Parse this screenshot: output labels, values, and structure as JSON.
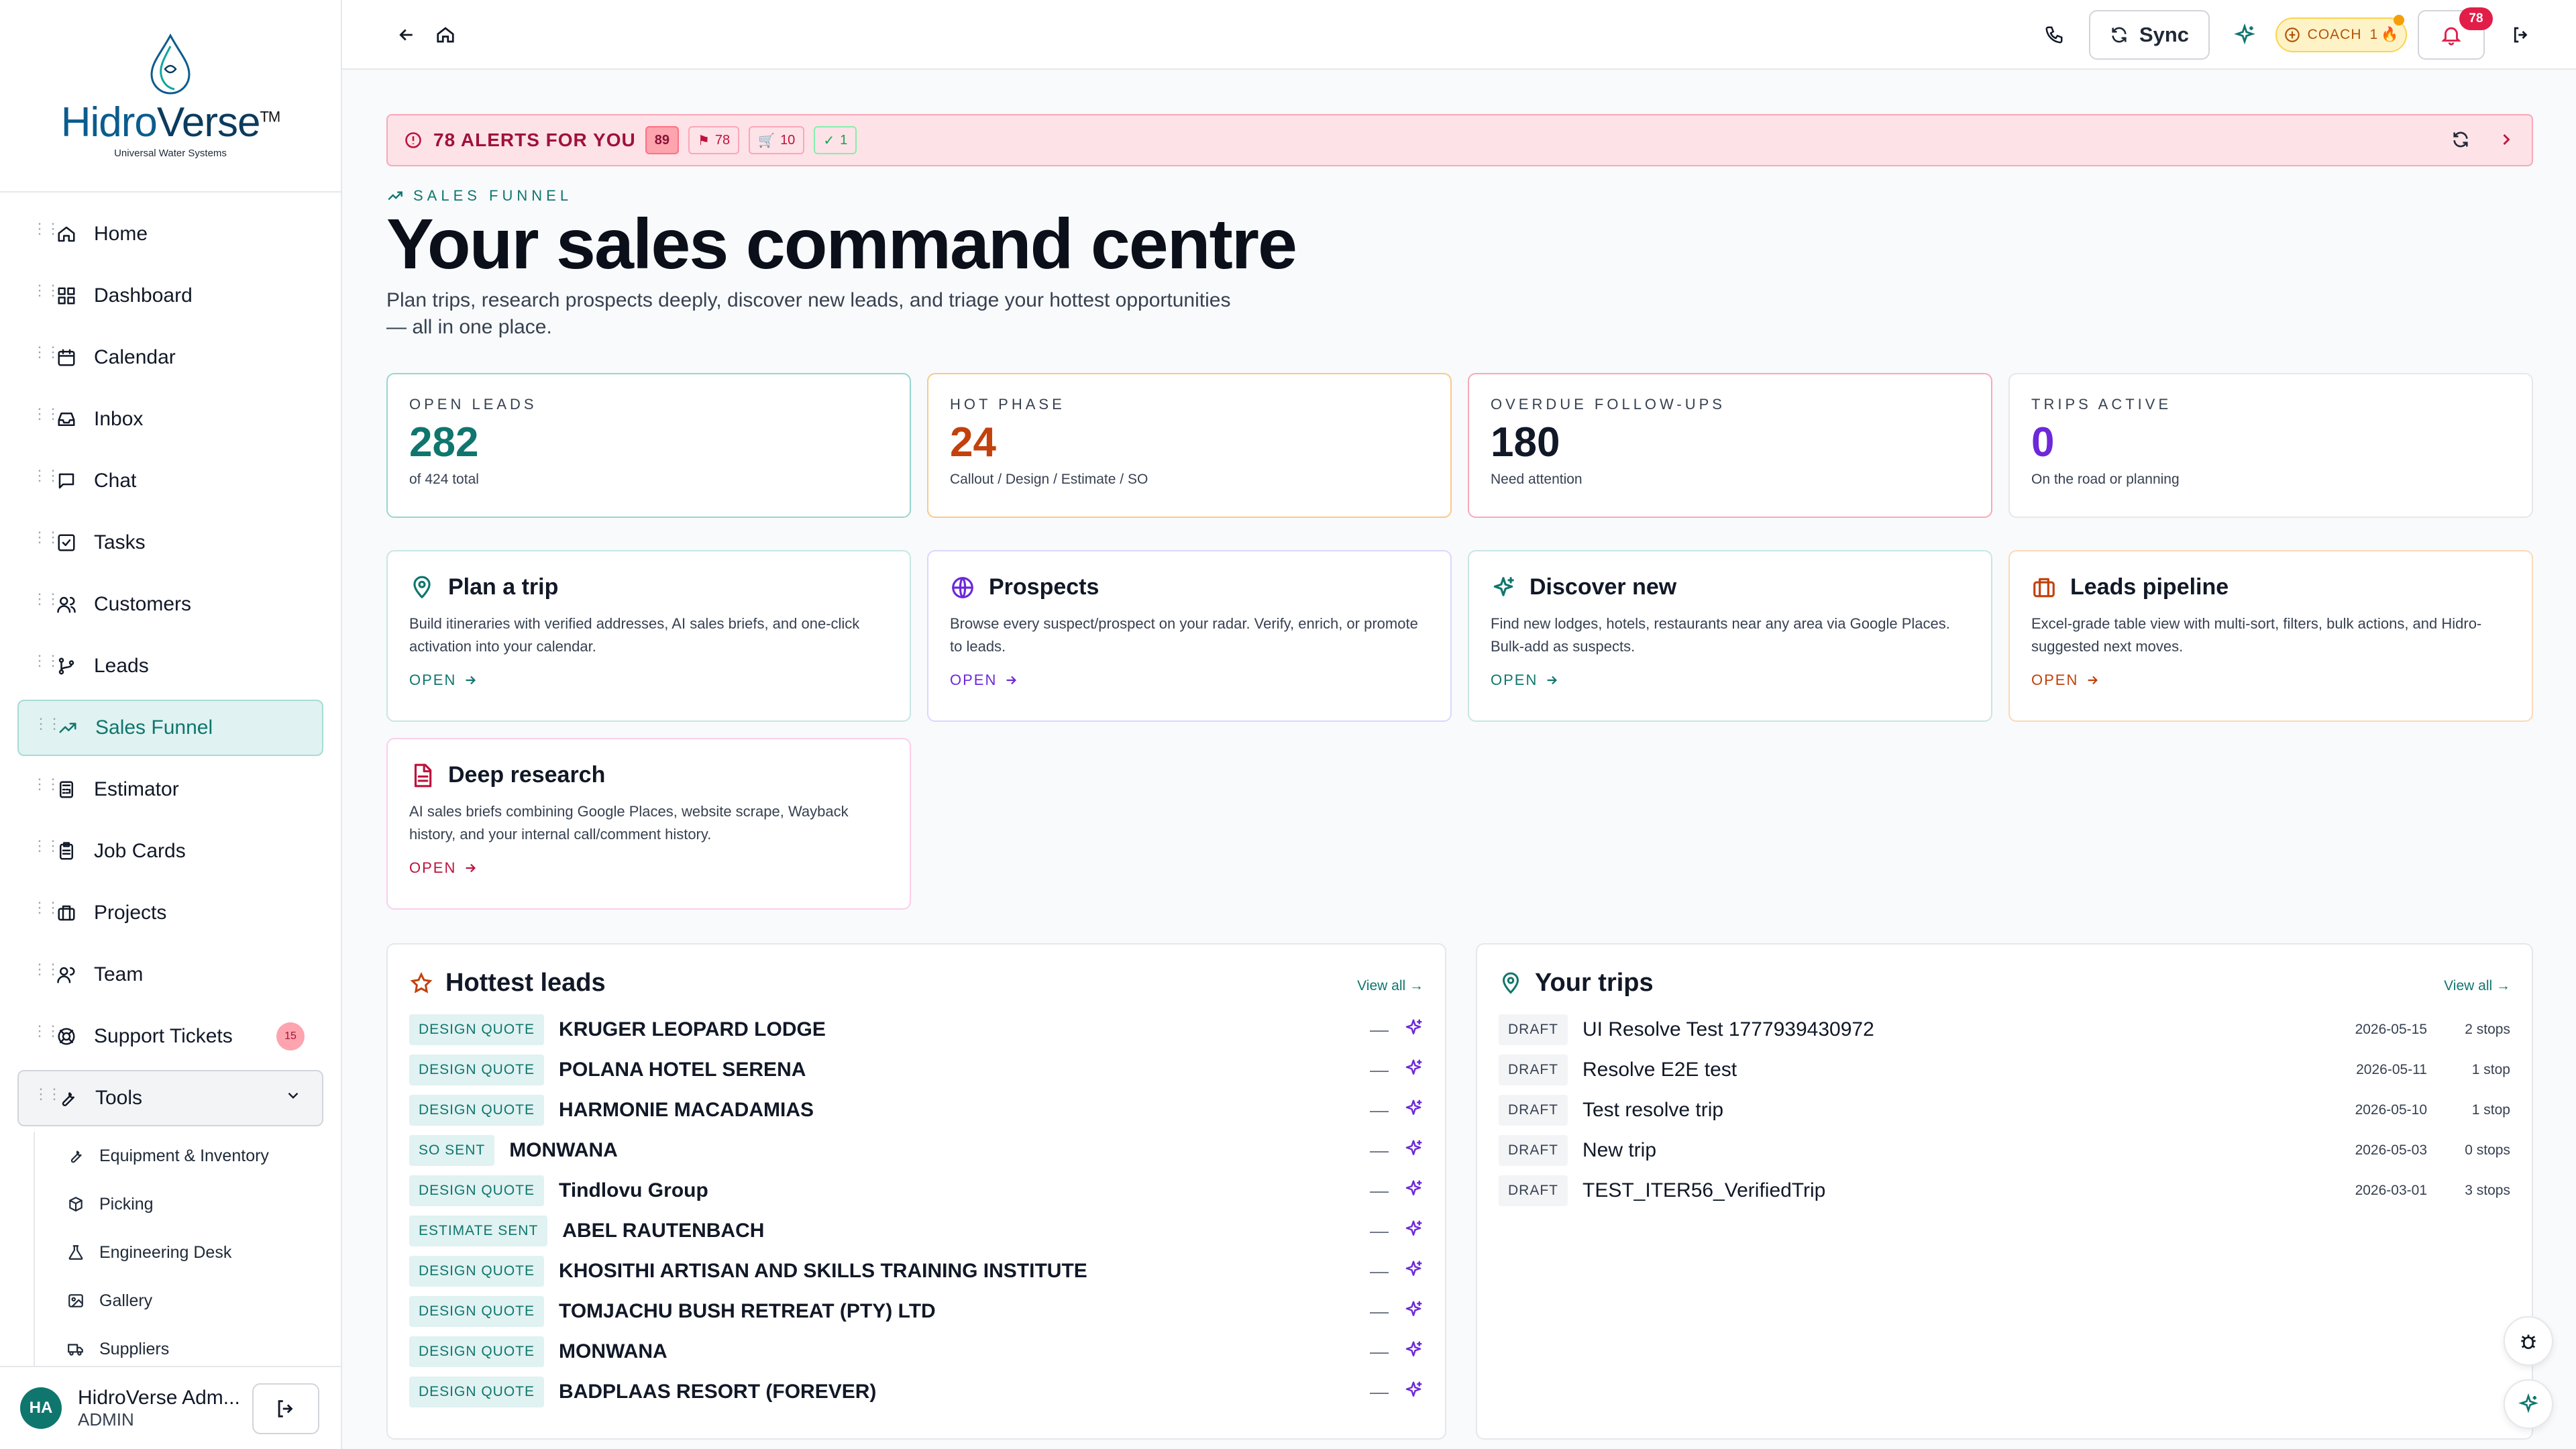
{
  "brand": {
    "name_a": "Hidro",
    "name_b": "Verse",
    "tm": "TM",
    "tagline": "Universal Water Systems"
  },
  "sidebar": {
    "items": [
      {
        "label": "Home",
        "icon": "home-icon"
      },
      {
        "label": "Dashboard",
        "icon": "dashboard-icon"
      },
      {
        "label": "Calendar",
        "icon": "calendar-icon"
      },
      {
        "label": "Inbox",
        "icon": "inbox-icon"
      },
      {
        "label": "Chat",
        "icon": "chat-icon"
      },
      {
        "label": "Tasks",
        "icon": "tasks-icon"
      },
      {
        "label": "Customers",
        "icon": "customers-icon"
      },
      {
        "label": "Leads",
        "icon": "leads-icon"
      },
      {
        "label": "Sales Funnel",
        "icon": "trending-up-icon",
        "active": true
      },
      {
        "label": "Estimator",
        "icon": "calculator-icon"
      },
      {
        "label": "Job Cards",
        "icon": "clipboard-icon"
      },
      {
        "label": "Projects",
        "icon": "briefcase-icon"
      },
      {
        "label": "Team",
        "icon": "team-icon"
      },
      {
        "label": "Support Tickets",
        "icon": "lifebuoy-icon",
        "badge": "15"
      },
      {
        "label": "Tools",
        "icon": "wrench-icon"
      }
    ],
    "tools_sub": [
      {
        "label": "Equipment & Inventory",
        "icon": "wrench-icon"
      },
      {
        "label": "Picking",
        "icon": "package-icon"
      },
      {
        "label": "Engineering Desk",
        "icon": "flask-icon"
      },
      {
        "label": "Gallery",
        "icon": "image-icon"
      },
      {
        "label": "Suppliers",
        "icon": "truck-icon"
      }
    ],
    "user": {
      "initials": "HA",
      "name": "HidroVerse Adm...",
      "role": "ADMIN"
    }
  },
  "topbar": {
    "sync_label": "Sync",
    "coach_label": "COACH",
    "coach_count": "1",
    "notifications": "78"
  },
  "alerts": {
    "title": "78 ALERTS FOR YOU",
    "total": "89",
    "chip_urgent": "78",
    "chip_cart": "10",
    "chip_ok": "1"
  },
  "hero": {
    "eyebrow": "SALES FUNNEL",
    "title": "Your sales command centre",
    "subtitle_1": "Plan trips, research prospects deeply, discover new leads, and triage your hottest opportunities",
    "subtitle_2": "— all in one place."
  },
  "stats": [
    {
      "label": "OPEN LEADS",
      "value": "282",
      "note": "of 424 total",
      "color": "#0f766e"
    },
    {
      "label": "HOT PHASE",
      "value": "24",
      "note": "Callout / Design / Estimate / SO",
      "color": "#c2410c"
    },
    {
      "label": "OVERDUE FOLLOW-UPS",
      "value": "180",
      "note": "Need attention",
      "color": "#111827"
    },
    {
      "label": "TRIPS ACTIVE",
      "value": "0",
      "note": "On the road or planning",
      "color": "#6d28d9"
    }
  ],
  "cards": [
    {
      "title": "Plan a trip",
      "desc": "Build itineraries with verified addresses, AI sales briefs, and one-click activation into your calendar.",
      "open": "OPEN",
      "color": "#0f766e",
      "icon": "map-pin-icon"
    },
    {
      "title": "Prospects",
      "desc": "Browse every suspect/prospect on your radar. Verify, enrich, or promote to leads.",
      "open": "OPEN",
      "color": "#6d28d9",
      "icon": "globe-icon"
    },
    {
      "title": "Discover new",
      "desc": "Find new lodges, hotels, restaurants near any area via Google Places. Bulk-add as suspects.",
      "open": "OPEN",
      "color": "#0f766e",
      "icon": "sparkles-icon"
    },
    {
      "title": "Leads pipeline",
      "desc": "Excel-grade table view with multi-sort, filters, bulk actions, and Hidro-suggested next moves.",
      "open": "OPEN",
      "color": "#c2410c",
      "icon": "briefcase-icon"
    },
    {
      "title": "Deep research",
      "desc": "AI sales briefs combining Google Places, website scrape, Wayback history, and your internal call/comment history.",
      "open": "OPEN",
      "color": "#be123c",
      "icon": "document-icon"
    }
  ],
  "hottest": {
    "title": "Hottest leads",
    "view_all": "View all →",
    "rows": [
      {
        "tag": "DESIGN QUOTE",
        "name": "KRUGER LEOPARD LODGE",
        "dash": "—"
      },
      {
        "tag": "DESIGN QUOTE",
        "name": "POLANA HOTEL SERENA",
        "dash": "—"
      },
      {
        "tag": "DESIGN QUOTE",
        "name": "HARMONIE MACADAMIAS",
        "dash": "—"
      },
      {
        "tag": "SO SENT",
        "name": "MONWANA",
        "dash": "—"
      },
      {
        "tag": "DESIGN QUOTE",
        "name": "Tindlovu Group",
        "dash": "—"
      },
      {
        "tag": "ESTIMATE SENT",
        "name": "ABEL RAUTENBACH",
        "dash": "—"
      },
      {
        "tag": "DESIGN QUOTE",
        "name": "KHOSITHI ARTISAN AND SKILLS TRAINING INSTITUTE",
        "dash": "—"
      },
      {
        "tag": "DESIGN QUOTE",
        "name": "TOMJACHU BUSH RETREAT (PTY) LTD",
        "dash": "—"
      },
      {
        "tag": "DESIGN QUOTE",
        "name": "MONWANA",
        "dash": "—"
      },
      {
        "tag": "DESIGN QUOTE",
        "name": "BADPLAAS RESORT (FOREVER)",
        "dash": "—"
      }
    ]
  },
  "trips": {
    "title": "Your trips",
    "view_all": "View all →",
    "rows": [
      {
        "tag": "DRAFT",
        "name": "UI Resolve Test 1777939430972",
        "date": "2026-05-15",
        "stops": "2 stops"
      },
      {
        "tag": "DRAFT",
        "name": "Resolve E2E test",
        "date": "2026-05-11",
        "stops": "1 stop"
      },
      {
        "tag": "DRAFT",
        "name": "Test resolve trip",
        "date": "2026-05-10",
        "stops": "1 stop"
      },
      {
        "tag": "DRAFT",
        "name": "New trip",
        "date": "2026-05-03",
        "stops": "0 stops"
      },
      {
        "tag": "DRAFT",
        "name": "TEST_ITER56_VerifiedTrip",
        "date": "2026-03-01",
        "stops": "3 stops"
      }
    ]
  }
}
